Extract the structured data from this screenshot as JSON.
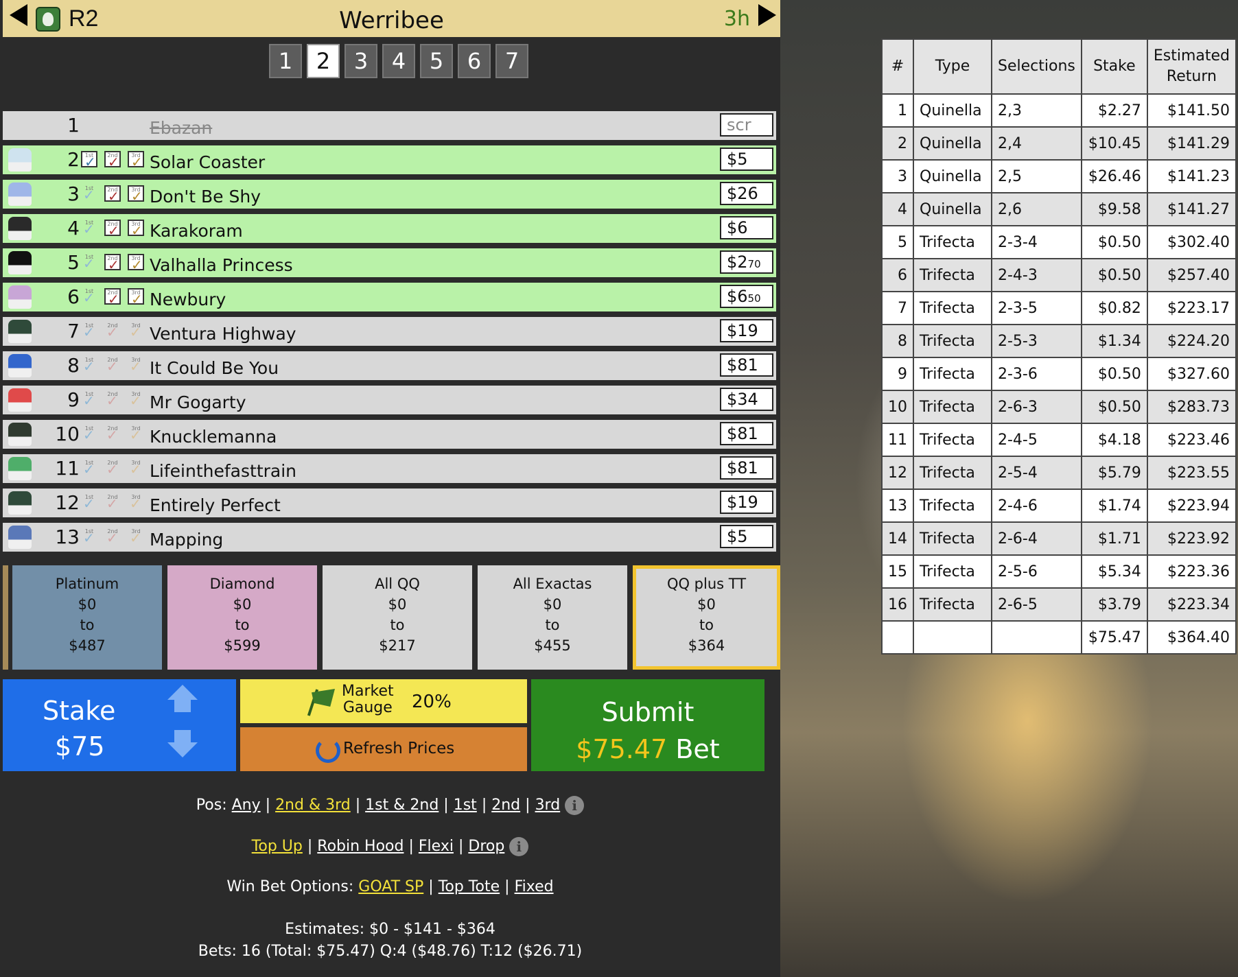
{
  "header": {
    "race": "R2",
    "venue": "Werribee",
    "time_to_start": "3h"
  },
  "race_tabs": [
    "1",
    "2",
    "3",
    "4",
    "5",
    "6",
    "7"
  ],
  "active_race_index": 1,
  "runners": [
    {
      "num": "1",
      "name": "Ebazan",
      "price": "scr",
      "scratched": true,
      "selected": false,
      "checks": [
        false,
        false,
        false
      ],
      "silk": "none"
    },
    {
      "num": "2",
      "name": "Solar Coaster",
      "price": "$5",
      "scratched": false,
      "selected": true,
      "checks": [
        true,
        true,
        true
      ],
      "silk": "#cfe3ef"
    },
    {
      "num": "3",
      "name": "Don't Be Shy",
      "price": "$26",
      "scratched": false,
      "selected": true,
      "checks": [
        false,
        true,
        true
      ],
      "silk": "#9fb6e8"
    },
    {
      "num": "4",
      "name": "Karakoram",
      "price": "$6",
      "scratched": false,
      "selected": true,
      "checks": [
        false,
        true,
        true
      ],
      "silk": "#2a2a2a"
    },
    {
      "num": "5",
      "name": "Valhalla Princess",
      "price": "$2",
      "price_small": "70",
      "scratched": false,
      "selected": true,
      "checks": [
        false,
        true,
        true
      ],
      "silk": "#111111"
    },
    {
      "num": "6",
      "name": "Newbury",
      "price": "$6",
      "price_small": "50",
      "scratched": false,
      "selected": true,
      "checks": [
        false,
        true,
        true
      ],
      "silk": "#c8a6d6"
    },
    {
      "num": "7",
      "name": "Ventura Highway",
      "price": "$19",
      "scratched": false,
      "selected": false,
      "checks": [
        false,
        false,
        false
      ],
      "silk": "#2f4a3a"
    },
    {
      "num": "8",
      "name": "It Could Be You",
      "price": "$81",
      "scratched": false,
      "selected": false,
      "checks": [
        false,
        false,
        false
      ],
      "silk": "#3366cc"
    },
    {
      "num": "9",
      "name": "Mr Gogarty",
      "price": "$34",
      "scratched": false,
      "selected": false,
      "checks": [
        false,
        false,
        false
      ],
      "silk": "#e04a4a"
    },
    {
      "num": "10",
      "name": "Knucklemanna",
      "price": "$81",
      "scratched": false,
      "selected": false,
      "checks": [
        false,
        false,
        false
      ],
      "silk": "#2f3a2f"
    },
    {
      "num": "11",
      "name": "Lifeinthefasttrain",
      "price": "$81",
      "scratched": false,
      "selected": false,
      "checks": [
        false,
        false,
        false
      ],
      "silk": "#4fae6a"
    },
    {
      "num": "12",
      "name": "Entirely Perfect",
      "price": "$19",
      "scratched": false,
      "selected": false,
      "checks": [
        false,
        false,
        false
      ],
      "silk": "#2f4a3a"
    },
    {
      "num": "13",
      "name": "Mapping",
      "price": "$5",
      "scratched": false,
      "selected": false,
      "checks": [
        false,
        false,
        false
      ],
      "silk": "#5a78b8"
    }
  ],
  "check_labels": [
    "1st",
    "2nd",
    "3rd"
  ],
  "bet_types": [
    {
      "name": "Platinum",
      "from": "$0",
      "to_word": "to",
      "to": "$487"
    },
    {
      "name": "Diamond",
      "from": "$0",
      "to_word": "to",
      "to": "$599"
    },
    {
      "name": "All QQ",
      "from": "$0",
      "to_word": "to",
      "to": "$217"
    },
    {
      "name": "All Exactas",
      "from": "$0",
      "to_word": "to",
      "to": "$455"
    },
    {
      "name": "QQ plus TT",
      "from": "$0",
      "to_word": "to",
      "to": "$364"
    }
  ],
  "stake": {
    "label": "Stake",
    "value": "$75"
  },
  "market_gauge": {
    "line1": "Market",
    "line2": "Gauge",
    "percent": "20%"
  },
  "refresh": {
    "label": "Refresh Prices"
  },
  "submit": {
    "label": "Submit",
    "amount": "$75.47",
    "suffix": "Bet"
  },
  "options": {
    "pos_label": "Pos:",
    "pos": [
      "Any",
      "2nd & 3rd",
      "1st & 2nd",
      "1st",
      "2nd",
      "3rd"
    ],
    "pos_active": "2nd & 3rd",
    "modes": [
      "Top Up",
      "Robin Hood",
      "Flexi",
      "Drop"
    ],
    "mode_active": "Top Up",
    "win_label": "Win Bet Options:",
    "win": [
      "GOAT SP",
      "Top Tote",
      "Fixed"
    ],
    "win_active": "GOAT SP",
    "info_glyph": "i",
    "sep": "|"
  },
  "summary": {
    "estimates": "Estimates: $0 - $141 - $364",
    "bets": "Bets: 16 (Total: $75.47) Q:4 ($48.76) T:12 ($26.71)"
  },
  "bets_table": {
    "headers": [
      "#",
      "Type",
      "Selections",
      "Stake",
      "Estimated Return"
    ],
    "rows": [
      [
        "1",
        "Quinella",
        "2,3",
        "$2.27",
        "$141.50"
      ],
      [
        "2",
        "Quinella",
        "2,4",
        "$10.45",
        "$141.29"
      ],
      [
        "3",
        "Quinella",
        "2,5",
        "$26.46",
        "$141.23"
      ],
      [
        "4",
        "Quinella",
        "2,6",
        "$9.58",
        "$141.27"
      ],
      [
        "5",
        "Trifecta",
        "2-3-4",
        "$0.50",
        "$302.40"
      ],
      [
        "6",
        "Trifecta",
        "2-4-3",
        "$0.50",
        "$257.40"
      ],
      [
        "7",
        "Trifecta",
        "2-3-5",
        "$0.82",
        "$223.17"
      ],
      [
        "8",
        "Trifecta",
        "2-5-3",
        "$1.34",
        "$224.20"
      ],
      [
        "9",
        "Trifecta",
        "2-3-6",
        "$0.50",
        "$327.60"
      ],
      [
        "10",
        "Trifecta",
        "2-6-3",
        "$0.50",
        "$283.73"
      ],
      [
        "11",
        "Trifecta",
        "2-4-5",
        "$4.18",
        "$223.46"
      ],
      [
        "12",
        "Trifecta",
        "2-5-4",
        "$5.79",
        "$223.55"
      ],
      [
        "13",
        "Trifecta",
        "2-4-6",
        "$1.74",
        "$223.94"
      ],
      [
        "14",
        "Trifecta",
        "2-6-4",
        "$1.71",
        "$223.92"
      ],
      [
        "15",
        "Trifecta",
        "2-5-6",
        "$5.34",
        "$223.36"
      ],
      [
        "16",
        "Trifecta",
        "2-6-5",
        "$3.79",
        "$223.34"
      ]
    ],
    "total_stake": "$75.47",
    "total_return": "$364.40"
  },
  "colors": {
    "header_bg": "#e8d697",
    "selected_row": "#b9f2a8",
    "stake_blue": "#1f6ee8",
    "gauge_yellow": "#f4e754",
    "refresh_orange": "#d68233",
    "submit_green": "#2a8a1f",
    "amount_gold": "#f4c51c"
  }
}
